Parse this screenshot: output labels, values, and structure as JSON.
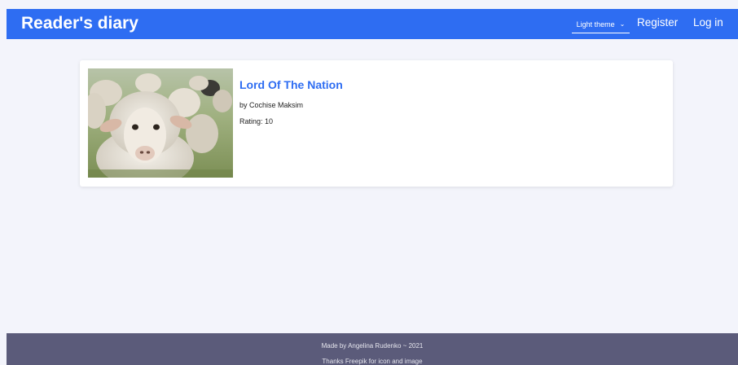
{
  "header": {
    "brand": "Reader's diary",
    "theme_select": {
      "selected": "Light theme"
    },
    "register": "Register",
    "login": "Log in"
  },
  "book": {
    "cover_icon": "sheep-photo",
    "title": "Lord Of The Nation",
    "author": "by Cochise Maksim",
    "rating": "Rating: 10"
  },
  "footer": {
    "credit": "Made by Angelina Rudenko ~ 2021",
    "thanks": "Thanks Freepik for icon and image"
  },
  "colors": {
    "accent": "#2e6df2",
    "background": "#f3f4fb",
    "footer": "#5b5b7a"
  }
}
